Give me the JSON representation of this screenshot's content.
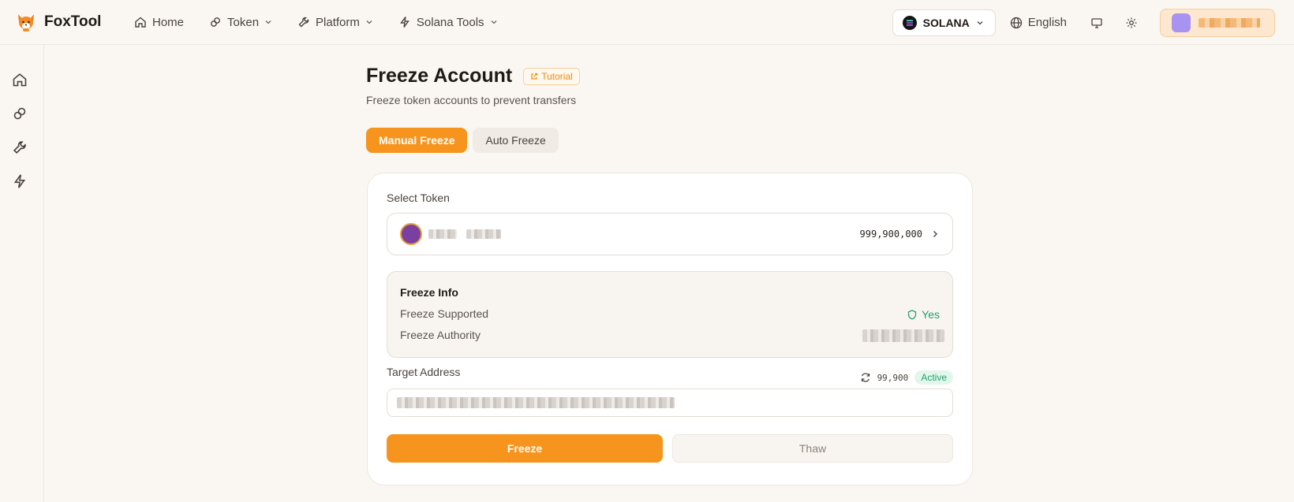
{
  "brand": {
    "name": "FoxTool"
  },
  "nav": {
    "home": "Home",
    "token": "Token",
    "platform": "Platform",
    "solana_tools": "Solana Tools"
  },
  "header": {
    "chain": "SOLANA",
    "language": "English"
  },
  "page": {
    "title": "Freeze Account",
    "tutorial": "Tutorial",
    "subtitle": "Freeze token accounts to prevent transfers"
  },
  "tabs": [
    {
      "label": "Manual Freeze",
      "active": true
    },
    {
      "label": "Auto Freeze",
      "active": false
    }
  ],
  "form": {
    "select_token_label": "Select Token",
    "token_balance": "999,900,000",
    "freeze_info_title": "Freeze Info",
    "freeze_supported_label": "Freeze Supported",
    "freeze_supported_value": "Yes",
    "freeze_authority_label": "Freeze Authority",
    "target_address_label": "Target Address",
    "target_count": "99,900",
    "target_status": "Active",
    "freeze_button": "Freeze",
    "thaw_button": "Thaw"
  },
  "colors": {
    "accent": "#f7941d",
    "success": "#22a06b",
    "background": "#faf7f3"
  }
}
